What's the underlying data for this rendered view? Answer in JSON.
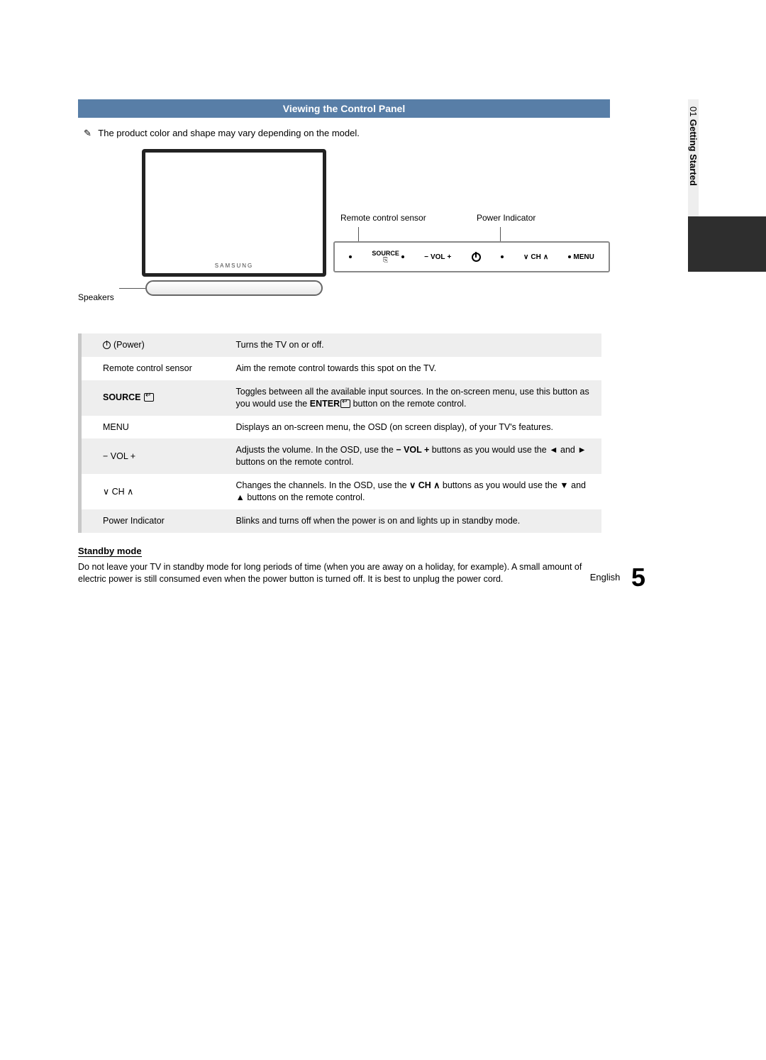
{
  "sidebar": {
    "chapter": "01",
    "title": "Getting Started"
  },
  "section": {
    "title": "Viewing the Control Panel"
  },
  "note": "The product color and shape may vary depending on the model.",
  "diagram": {
    "brand": "SAMSUNG",
    "labels": {
      "speakers": "Speakers",
      "remote_sensor": "Remote control sensor",
      "power_indicator": "Power Indicator"
    },
    "panel": {
      "source": "SOURCE",
      "source_icon_hint": "⎘",
      "vol": "VOL",
      "ch": "CH",
      "menu": "MENU"
    }
  },
  "table": {
    "rows": [
      {
        "label_pre_icon": "power",
        "label": "(Power)",
        "desc": "Turns the TV on or off."
      },
      {
        "label": "Remote control sensor",
        "desc": "Aim the remote control towards this spot on the TV."
      },
      {
        "label_html": "SOURCE",
        "label_icon_after": "enter",
        "desc_parts": [
          "Toggles between all the available input sources. In the on-screen menu, use this button as you would use the ",
          "ENTER",
          " button on the remote control."
        ]
      },
      {
        "label": "MENU",
        "desc": "Displays an on-screen menu, the OSD (on screen display), of your TV's features."
      },
      {
        "label_bold": "− VOL +",
        "desc_parts": [
          "Adjusts the volume. In the OSD, use the ",
          "− VOL +",
          " buttons as you would use the ◄ and ► buttons on the remote control."
        ]
      },
      {
        "label_bold": "∨ CH ∧",
        "desc_parts": [
          "Changes the channels. In the OSD, use the ",
          "∨ CH ∧",
          " buttons as you would use the ▼ and ▲ buttons on the remote control."
        ]
      },
      {
        "label": "Power Indicator",
        "desc": "Blinks and turns off when the power is on and lights up in standby mode."
      }
    ]
  },
  "standby": {
    "heading": "Standby mode",
    "text": "Do not leave your TV in standby mode for long periods of time (when you are away on a holiday, for example). A small amount of electric power is still consumed even when the power button is turned off. It is best to unplug the power cord."
  },
  "footer": {
    "language": "English",
    "page": "5"
  }
}
